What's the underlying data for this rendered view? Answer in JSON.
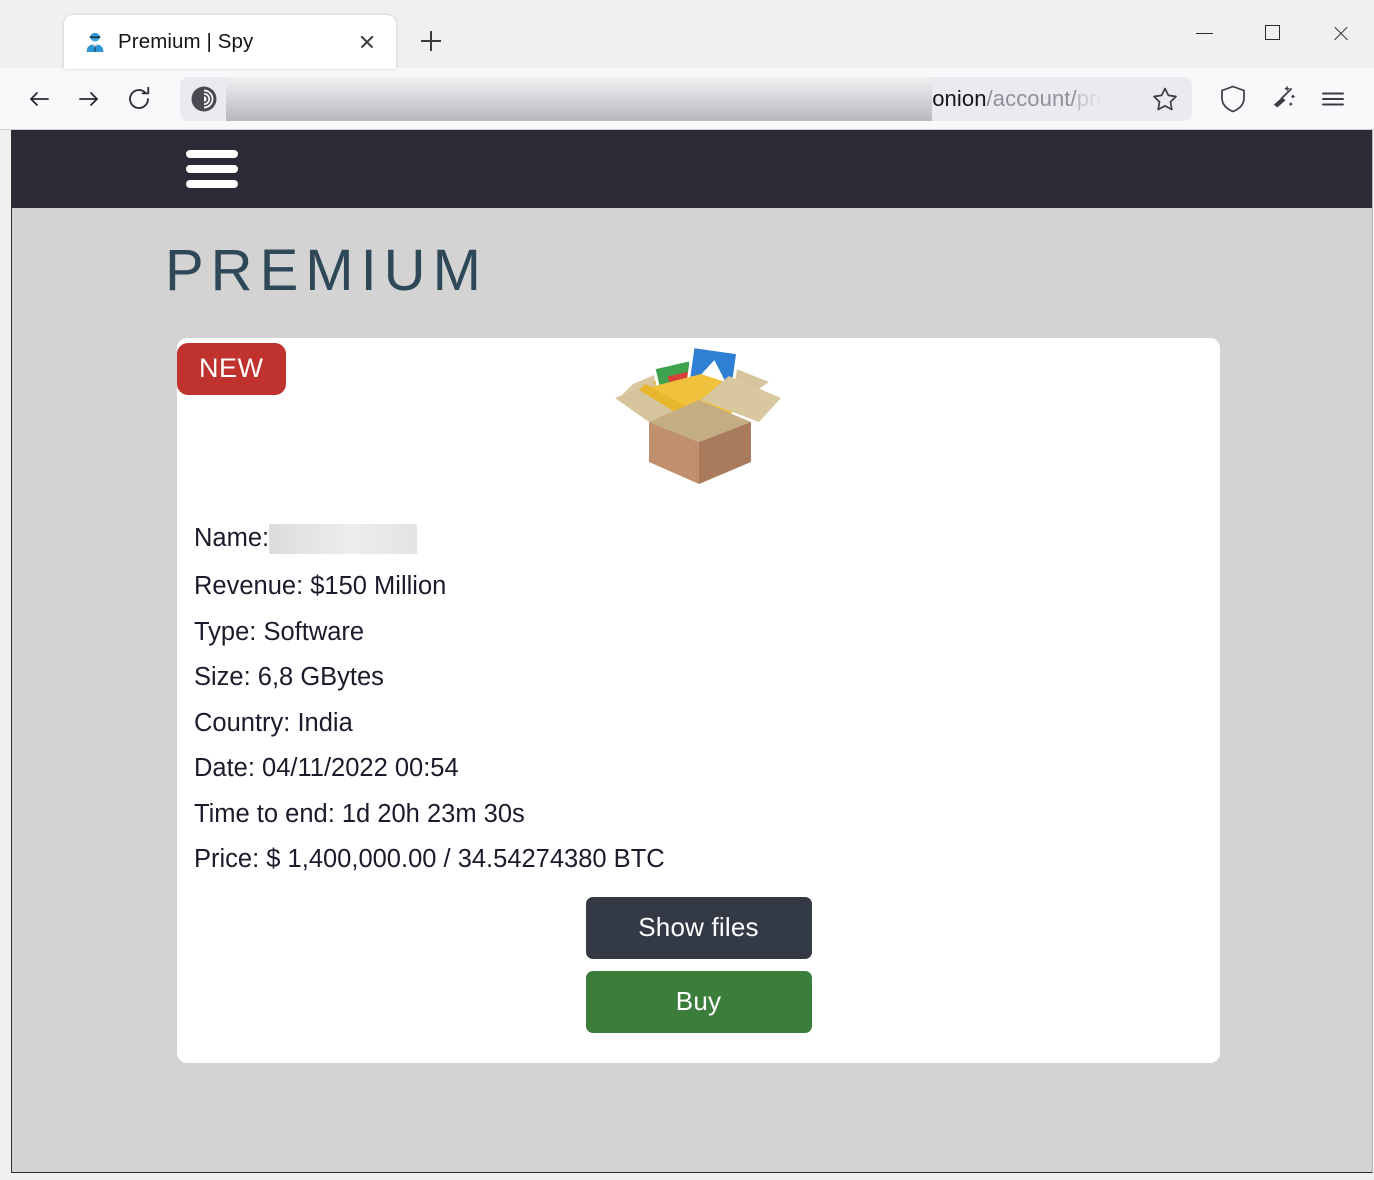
{
  "browser": {
    "tab": {
      "favicon": "spy-avatar-icon",
      "title": "Premium | Spy",
      "close_icon": "close-icon"
    },
    "new_tab_icon": "plus-icon",
    "window_controls": {
      "minimize": "minimize-icon",
      "maximize": "maximize-icon",
      "close": "close-icon"
    },
    "toolbar": {
      "back_icon": "back-arrow-icon",
      "forward_icon": "forward-arrow-icon",
      "reload_icon": "reload-icon",
      "site_identity_icon": "tor-onion-icon",
      "url_redacted": true,
      "url_domain": ".onion",
      "url_path": "/account/",
      "url_path_faded": "pre",
      "bookmark_icon": "star-icon",
      "shield_icon": "shield-icon",
      "new_identity_icon": "broom-icon",
      "menu_icon": "hamburger-menu-icon"
    }
  },
  "site": {
    "nav_menu_icon": "hamburger-menu-icon",
    "heading": "PREMIUM",
    "card": {
      "badge": "NEW",
      "artwork": "open-box-with-files-icon",
      "details": [
        {
          "label": "Name:",
          "value": "",
          "redacted": true
        },
        {
          "label": "Revenue: ",
          "value": "$150 Million",
          "redacted": false
        },
        {
          "label": "Type: ",
          "value": "Software",
          "redacted": false
        },
        {
          "label": "Size: ",
          "value": "6,8 GBytes",
          "redacted": false
        },
        {
          "label": "Country: ",
          "value": "India",
          "redacted": false
        },
        {
          "label": "Date: ",
          "value": "04/11/2022 00:54",
          "redacted": false
        },
        {
          "label": "Time to end: ",
          "value": "1d 20h 23m 30s",
          "redacted": false
        },
        {
          "label": "Price: ",
          "value": "$ 1,400,000.00 / 34.54274380 BTC",
          "redacted": false
        }
      ],
      "show_files_label": "Show files",
      "buy_label": "Buy"
    }
  },
  "colors": {
    "page_background": "#d3d3d3",
    "nav_background": "#2b2b38",
    "heading": "#2f4858",
    "badge_red": "#c0322d",
    "button_dark": "#343a45",
    "button_green": "#3b7d3b",
    "card_background": "#ffffff"
  }
}
